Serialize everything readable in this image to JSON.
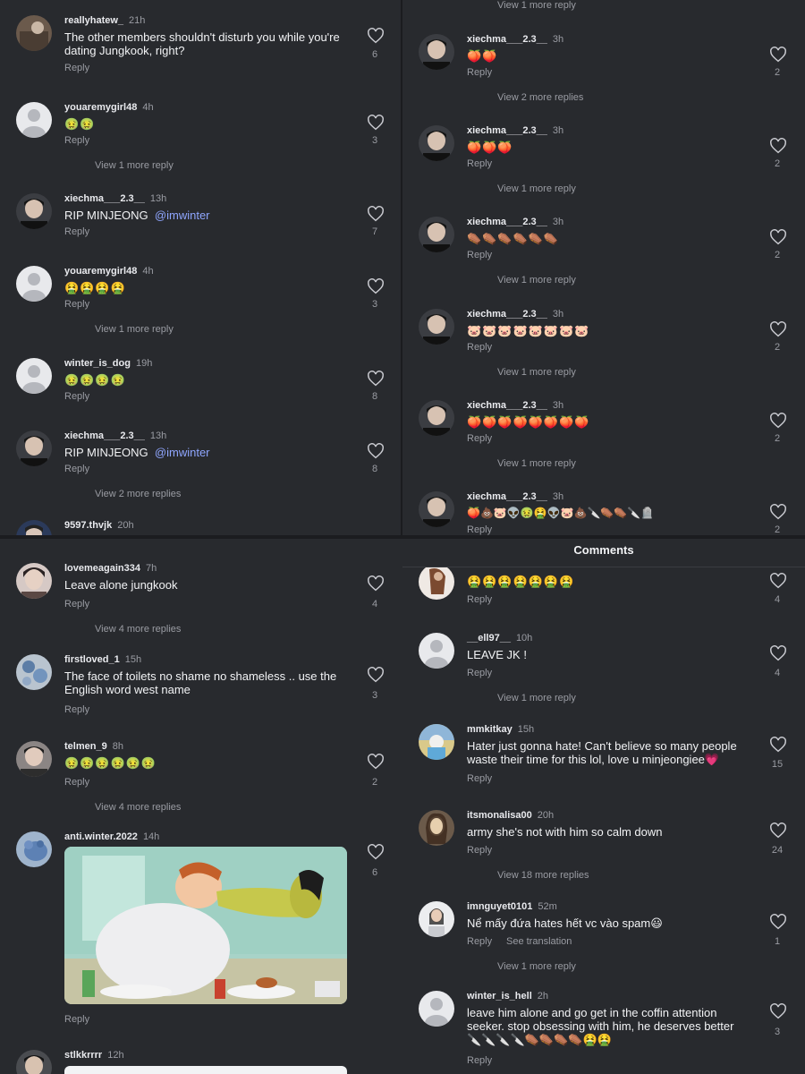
{
  "header": {
    "title": "Comments"
  },
  "colors": {
    "bg": "#282a2e",
    "text": "#f2f3f5",
    "muted": "#9a9ca3",
    "mention": "#8fa6ff"
  },
  "q1": [
    {
      "user": "reallyhatew_",
      "time": "21h",
      "text": "The other members shouldn't disturb you while you're dating Jungkook, right?",
      "likes": "6",
      "reply": "Reply"
    },
    {
      "user": "youaremygirl48",
      "time": "4h",
      "text": "🤢🤢",
      "likes": "3",
      "reply": "Reply",
      "view": "View 1 more reply"
    },
    {
      "user": "xiechma___2.3__",
      "time": "13h",
      "text": "RIP MINJEONG",
      "mention": "@imwinter",
      "likes": "7",
      "reply": "Reply"
    },
    {
      "user": "youaremygirl48",
      "time": "4h",
      "text": "🤮🤮🤮🤮",
      "likes": "3",
      "reply": "Reply",
      "view": "View 1 more reply"
    },
    {
      "user": "winter_is_dog",
      "time": "19h",
      "text": "🤢🤢🤢🤢",
      "likes": "8",
      "reply": "Reply"
    },
    {
      "user": "xiechma___2.3__",
      "time": "13h",
      "text": "RIP MINJEONG",
      "mention": "@imwinter",
      "likes": "8",
      "reply": "Reply",
      "view": "View 2 more replies"
    },
    {
      "user": "9597.thvjk",
      "time": "20h"
    }
  ],
  "q2": [
    {
      "view": "View 1 more reply"
    },
    {
      "user": "xiechma___2.3__",
      "time": "3h",
      "text": "🍑🍑",
      "likes": "2",
      "reply": "Reply",
      "view": "View 2 more replies"
    },
    {
      "user": "xiechma___2.3__",
      "time": "3h",
      "text": "🍑🍑🍑",
      "likes": "2",
      "reply": "Reply",
      "view": "View 1 more reply"
    },
    {
      "user": "xiechma___2.3__",
      "time": "3h",
      "text": "⚰️⚰️⚰️⚰️⚰️⚰️",
      "likes": "2",
      "reply": "Reply",
      "view": "View 1 more reply"
    },
    {
      "user": "xiechma___2.3__",
      "time": "3h",
      "text": "🐷🐷🐷🐷🐷🐷🐷🐷",
      "likes": "2",
      "reply": "Reply",
      "view": "View 1 more reply"
    },
    {
      "user": "xiechma___2.3__",
      "time": "3h",
      "text": "🍑🍑🍑🍑🍑🍑🍑🍑",
      "likes": "2",
      "reply": "Reply",
      "view": "View 1 more reply"
    },
    {
      "user": "xiechma___2.3__",
      "time": "3h",
      "text": "🍑💩🐷👽🤢🤮👽🐷💩🔪⚰️⚰️🔪🪦",
      "likes": "2",
      "reply": "Reply"
    }
  ],
  "q3": [
    {
      "user": "lovemeagain334",
      "time": "7h",
      "text": "Leave alone jungkook",
      "likes": "4",
      "reply": "Reply",
      "view": "View 4 more replies"
    },
    {
      "user": "firstloved_1",
      "time": "15h",
      "text": "The face of toilets no shame no shameless .. use the English word  west name",
      "likes": "3",
      "reply": "Reply"
    },
    {
      "user": "telmen_9",
      "time": "8h",
      "text": "🤢🤢🤢🤢🤢🤢",
      "likes": "2",
      "reply": "Reply",
      "view": "View 4 more replies"
    },
    {
      "user": "anti.winter.2022",
      "time": "14h",
      "likes": "6",
      "reply": "Reply"
    },
    {
      "user": "stlkkrrrr",
      "time": "12h"
    }
  ],
  "q4": [
    {
      "text": "🤮🤮🤮🤮🤮🤮🤮",
      "likes": "4",
      "reply": "Reply"
    },
    {
      "user": "__ell97__",
      "time": "10h",
      "text": "LEAVE JK !",
      "likes": "4",
      "reply": "Reply",
      "view": "View 1 more reply"
    },
    {
      "user": "mmkitkay",
      "time": "15h",
      "text": "Hater just gonna hate! Can't believe so many people waste their time for this lol, love u minjeongiee💗",
      "likes": "15",
      "reply": "Reply"
    },
    {
      "user": "itsmonalisa00",
      "time": "20h",
      "text": "army she's not with him so calm down",
      "likes": "24",
      "reply": "Reply",
      "view": "View 18 more replies"
    },
    {
      "user": "imnguyet0101",
      "time": "52m",
      "text": "Nể mấy đứa hates hết vc vào spam😃",
      "likes": "1",
      "reply": "Reply",
      "see_translation": "See translation",
      "view": "View 1 more reply"
    },
    {
      "user": "winter_is_hell",
      "time": "2h",
      "text": "leave him alone and go get in the coffin attention seeker. stop obsessing with him, he deserves better 🔪🔪🔪🔪⚰️⚰️⚰️⚰️🤮🤮",
      "likes": "3",
      "reply": "Reply"
    }
  ]
}
